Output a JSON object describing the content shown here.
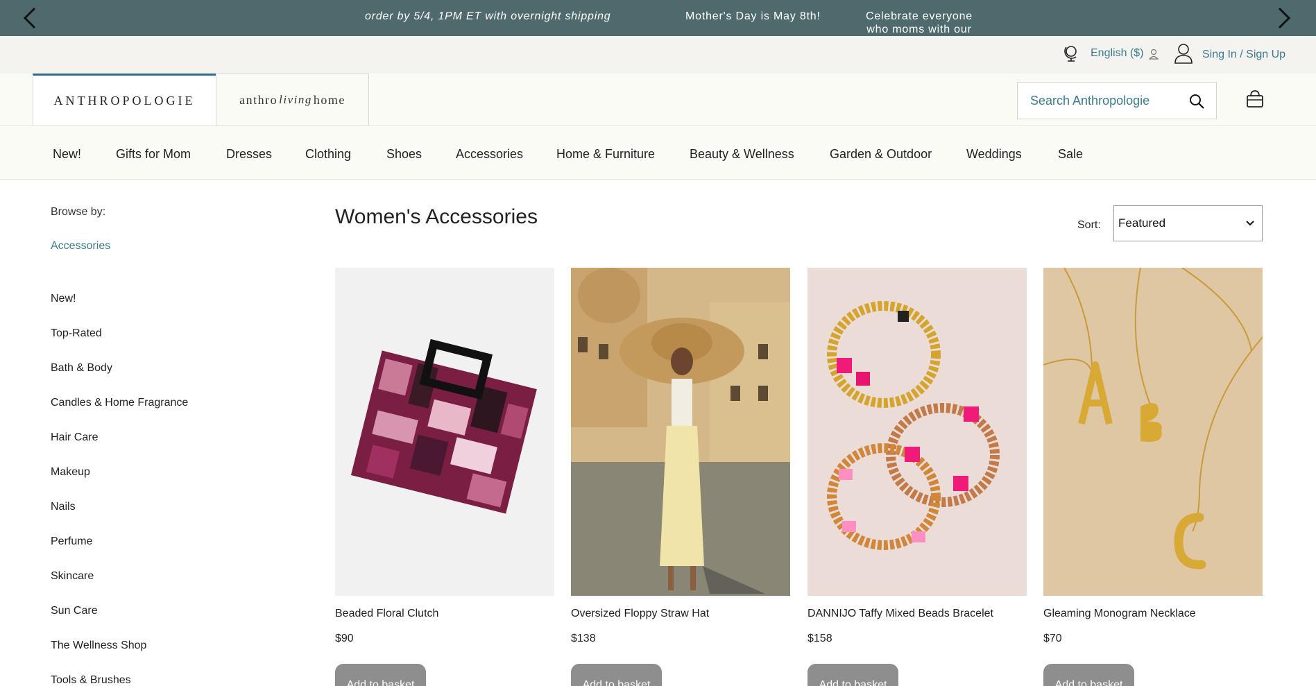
{
  "promo": {
    "messages": [
      "order by 5/4, 1PM ET with overnight shipping",
      "Mother's Day is May 8th!",
      "Celebrate everyone who moms with our gift guide!"
    ],
    "prev_icon": "chevron-left-icon",
    "next_icon": "chevron-right-icon",
    "background": "#4f6a6d"
  },
  "utility": {
    "language": "English ($)",
    "sign_in": "Sing In / Sign Up",
    "link_color": "#3c7b8d"
  },
  "header": {
    "brand": "ANTHROPOLOGIE",
    "living_home": {
      "left": "anthro",
      "script": "living",
      "right": "home"
    },
    "search_placeholder": "Search Anthropologie"
  },
  "nav": [
    "New!",
    "Gifts for Mom",
    "Dresses",
    "Clothing",
    "Shoes",
    "Accessories",
    "Home & Furniture",
    "Beauty & Wellness",
    "Garden & Outdoor",
    "Weddings",
    "Sale"
  ],
  "sidebar": {
    "browse_label": "Browse by:",
    "current": "Accessories",
    "items": [
      "New!",
      "Top-Rated",
      "Bath & Body",
      "Candles & Home Fragrance",
      "Hair Care",
      "Makeup",
      "Nails",
      "Perfume",
      "Skincare",
      "Sun Care",
      "The Wellness Shop",
      "Tools & Brushes"
    ]
  },
  "main": {
    "title": "Women's Accessories",
    "sort_label": "Sort:",
    "sort_value": "Featured",
    "add_label": "Add to basket",
    "products": [
      {
        "name": "Beaded Floral Clutch",
        "price": "$90"
      },
      {
        "name": "Oversized Floppy Straw Hat",
        "price": "$138"
      },
      {
        "name": "DANNIJO Taffy Mixed Beads Bracelet",
        "price": "$158"
      },
      {
        "name": "Gleaming Monogram Necklace",
        "price": "$70"
      }
    ]
  }
}
